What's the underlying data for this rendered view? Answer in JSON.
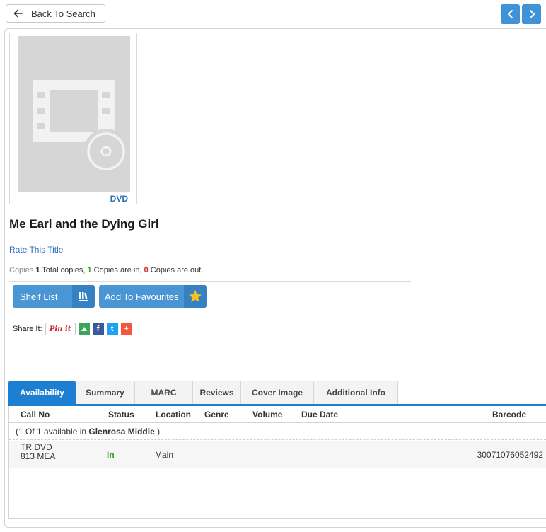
{
  "nav": {
    "back_label": "Back To Search",
    "prev_icon": "chevron-left-icon",
    "next_icon": "chevron-right-icon"
  },
  "item": {
    "format_label": "DVD",
    "title": "Me Earl and the Dying Girl",
    "rate_label": "Rate This Title",
    "copies": {
      "prefix": "Copies",
      "total": "1",
      "total_text": " Total copies, ",
      "in": "1",
      "in_text": " Copies are in, ",
      "out": "0",
      "out_text": " Copies are out."
    }
  },
  "actions": {
    "shelf_list_label": "Shelf List",
    "favourites_label": "Add To Favourites"
  },
  "share": {
    "label": "Share It:",
    "pinit_label": "Pin it",
    "facebook_glyph": "f",
    "twitter_glyph": "t",
    "plus_glyph": "+"
  },
  "tabs": [
    {
      "label": "Availability",
      "active": true
    },
    {
      "label": "Summary",
      "active": false
    },
    {
      "label": "MARC",
      "active": false
    },
    {
      "label": "Reviews",
      "active": false
    },
    {
      "label": "Cover Image",
      "active": false
    },
    {
      "label": "Additional Info",
      "active": false
    }
  ],
  "table": {
    "headers": {
      "call_no": "Call No",
      "status": "Status",
      "location": "Location",
      "genre": "Genre",
      "volume": "Volume",
      "due_date": "Due Date",
      "barcode": "Barcode"
    },
    "group": {
      "prefix": "(1 Of 1 available in ",
      "library": "Glenrosa Middle",
      "suffix": " )"
    },
    "rows": [
      {
        "call_no_line1": "TR DVD",
        "call_no_line2": "813 MEA",
        "status": "In",
        "location": "Main",
        "genre": "",
        "volume": "",
        "due_date": "",
        "barcode": "30071076052492"
      }
    ]
  },
  "colors": {
    "accent": "#1d7fd1",
    "button_blue": "#4a96d4",
    "status_in": "#3a9a1a",
    "status_out": "#d12c2c"
  }
}
